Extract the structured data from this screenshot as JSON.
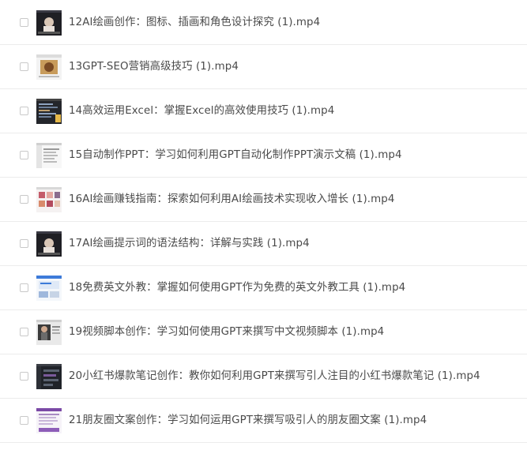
{
  "files": [
    {
      "name": "12AI绘画创作：图标、插画和角色设计探究 (1).mp4",
      "thumb": "dark-portrait"
    },
    {
      "name": "13GPT-SEO营销高级技巧 (1).mp4",
      "thumb": "product"
    },
    {
      "name": "14高效运用Excel：掌握Excel的高效使用技巧 (1).mp4",
      "thumb": "dark-code"
    },
    {
      "name": "15自动制作PPT：学习如何利用GPT自动化制作PPT演示文稿 (1).mp4",
      "thumb": "light-doc"
    },
    {
      "name": "16AI绘画赚钱指南：探索如何利用AI绘画技术实现收入增长 (1).mp4",
      "thumb": "pink-grid"
    },
    {
      "name": "17AI绘画提示词的语法结构：详解与实践 (1).mp4",
      "thumb": "dark-portrait"
    },
    {
      "name": "18免费英文外教：掌握如何使用GPT作为免费的英文外教工具 (1).mp4",
      "thumb": "blue-web"
    },
    {
      "name": "19视频脚本创作：学习如何使用GPT来撰写中文视频脚本 (1).mp4",
      "thumb": "video-person"
    },
    {
      "name": "20小红书爆款笔记创作：教你如何利用GPT来撰写引人注目的小红书爆款笔记 (1).mp4",
      "thumb": "dark-chat"
    },
    {
      "name": "21朋友圈文案创作：学习如何运用GPT来撰写吸引人的朋友圈文案 (1).mp4",
      "thumb": "purple-doc"
    }
  ]
}
